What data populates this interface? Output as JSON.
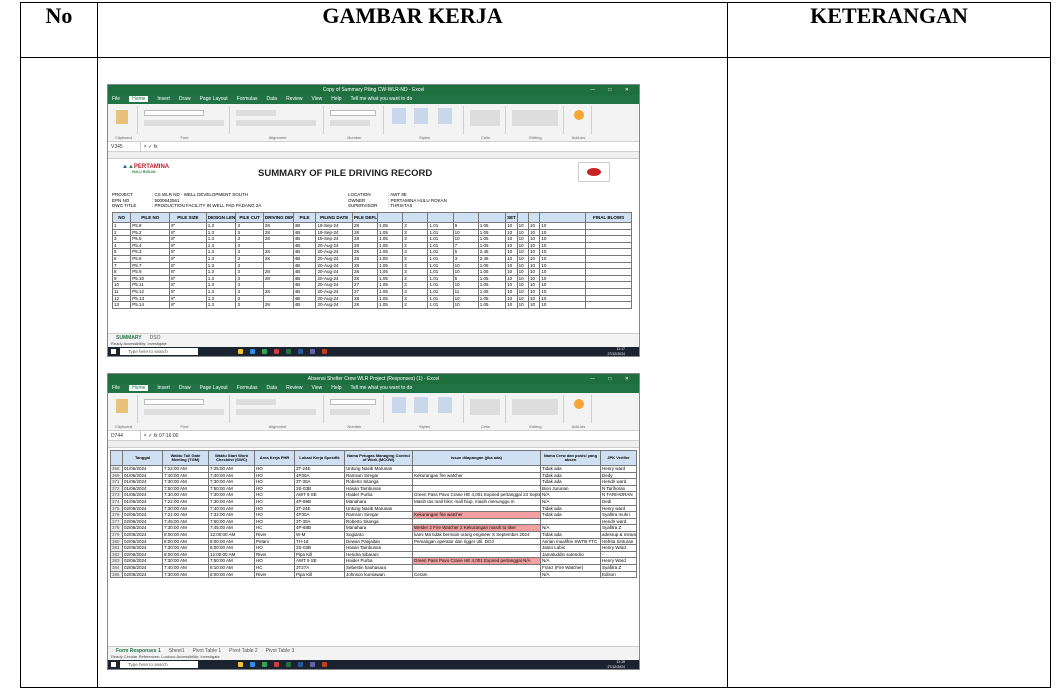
{
  "header": {
    "no": "No",
    "gambar": "GAMBAR KERJA",
    "keterangan": "KETERANGAN"
  },
  "shot1": {
    "window_title": "Copy of Summary Piling CW-WLR-ND - Excel",
    "menu": [
      "File",
      "Home",
      "Insert",
      "Draw",
      "Page Layout",
      "Formulas",
      "Data",
      "Review",
      "View",
      "Help",
      "Tell me what you want to do"
    ],
    "cell_ref": "V345",
    "company": "PERTAMINA",
    "company_sub": "HULU ROKAN",
    "sheet_title": "SUMMARY OF PILE DRIVING RECORD",
    "info_left": [
      {
        "k": "PROJECT",
        "v": ": CS WLR ND - WELL DEVELOPMENT SOUTH"
      },
      {
        "k": "EPN NO",
        "v": ": 5000642561"
      },
      {
        "k": "DWG TITLE",
        "v": ": PRODUCTION FACILITY IN WELL PAD PADANG 2A"
      }
    ],
    "info_right": [
      {
        "k": "LOCATION",
        "v": ": AWT 9E"
      },
      {
        "k": "OWNER",
        "v": ": PERTAMINA HULU ROKAN"
      },
      {
        "k": "SUPERVISOR",
        "v": ": THRISTAS"
      }
    ],
    "columns": [
      "NO",
      "PILE NO",
      "PILE SIZE",
      "DESIGN LENGTH",
      "PILE CUT",
      "DRIVING DEPTH",
      "PILE",
      "PILING DATE",
      "PILE DEFLECTION",
      "",
      "",
      "",
      "",
      "",
      "SET",
      "",
      "",
      "",
      "FINAL BLOWS",
      "REMARK"
    ],
    "rows": [
      [
        "1",
        "P5.8",
        "8\"",
        "1.3",
        "3",
        "28",
        "4B",
        "19-Sep-24",
        "28",
        "1.05",
        "3",
        "1.01",
        "9",
        "1.05",
        "10",
        "10",
        "10",
        "10"
      ],
      [
        "2",
        "P5.2",
        "8\"",
        "1.3",
        "3",
        "28",
        "4B",
        "19-Sep-24",
        "28",
        "1.05",
        "3",
        "1.01",
        "10",
        "1.05",
        "10",
        "10",
        "10",
        "10"
      ],
      [
        "3",
        "P5.5",
        "8\"",
        "1.3",
        "3",
        "28",
        "4B",
        "19-Sep-24",
        "28",
        "1.05",
        "3",
        "1.01",
        "10",
        "1.05",
        "10",
        "10",
        "10",
        "10"
      ],
      [
        "4",
        "P5.4",
        "8\"",
        "1.3",
        "3",
        "",
        "4B",
        "20-Aug-24",
        "28",
        "1.05",
        "2",
        "1.01",
        "7",
        "1.05",
        "10",
        "10",
        "10",
        "10"
      ],
      [
        "5",
        "P5.3",
        "8\"",
        "1.3",
        "3",
        "28",
        "4B",
        "20-Aug-24",
        "28",
        "1.05",
        "3",
        "1.01",
        "5",
        "2.46",
        "10",
        "10",
        "10",
        "10"
      ],
      [
        "6",
        "P5.6",
        "8\"",
        "1.3",
        "3",
        "28",
        "4B",
        "20-Aug-24",
        "28",
        "1.05",
        "2",
        "1.01",
        "3",
        "2.46",
        "10",
        "10",
        "10",
        "10"
      ],
      [
        "7",
        "P5.7",
        "8\"",
        "1.3",
        "3",
        "",
        "4B",
        "20-Aug-24",
        "28",
        "1.05",
        "3",
        "1.01",
        "10",
        "1.05",
        "10",
        "10",
        "10",
        "10"
      ],
      [
        "8",
        "P5.9",
        "8\"",
        "1.3",
        "3",
        "28",
        "4B",
        "20-Aug-24",
        "28",
        "1.05",
        "3",
        "1.01",
        "10",
        "1.05",
        "10",
        "10",
        "10",
        "10"
      ],
      [
        "9",
        "P5.10",
        "8\"",
        "1.3",
        "3",
        "28",
        "4B",
        "20-Aug-24",
        "28",
        "1.05",
        "2",
        "1.01",
        "5",
        "1.05",
        "10",
        "10",
        "10",
        "10"
      ],
      [
        "10",
        "P5.11",
        "8\"",
        "1.3",
        "3",
        "",
        "4B",
        "20-Aug-24",
        "27",
        "1.05",
        "3",
        "1.01",
        "10",
        "1.05",
        "10",
        "10",
        "10",
        "10"
      ],
      [
        "11",
        "P5.12",
        "8\"",
        "1.3",
        "3",
        "28",
        "4B",
        "20-Aug-24",
        "27",
        "1.05",
        "3",
        "1.01",
        "11",
        "1.05",
        "10",
        "10",
        "10",
        "10"
      ],
      [
        "12",
        "P5.13",
        "8\"",
        "1.3",
        "3",
        "",
        "4B",
        "20-Aug-24",
        "28",
        "1.05",
        "3",
        "1.01",
        "10",
        "1.05",
        "10",
        "10",
        "10",
        "10"
      ],
      [
        "13",
        "P5.14",
        "8\"",
        "1.3",
        "3",
        "28",
        "4B",
        "20-Aug-24",
        "28",
        "1.05",
        "2",
        "1.01",
        "10",
        "1.05",
        "10",
        "10",
        "10",
        "10"
      ]
    ],
    "sheets": [
      "SUMMARY",
      "DSO"
    ],
    "status": "Ready    Accessibility: Investigate",
    "search_placeholder": "Type here to search",
    "clock_time": "11:17",
    "clock_date": "27/12/2024"
  },
  "shot2": {
    "window_title": "Absensi Shelter Crew WLR Project (Responses) (1) - Excel",
    "menu": [
      "File",
      "Home",
      "Insert",
      "Draw",
      "Page Layout",
      "Formulas",
      "Data",
      "Review",
      "View",
      "Help",
      "Tell me what you want to do"
    ],
    "cell_ref": "D744",
    "formula": "07:16:00",
    "columns": [
      "Tanggal",
      "Waktu Toll Gate Meeting (TGM)",
      "Waktu Start Work Checklist (SWC)",
      "Area Kerja PHR",
      "Lokasi Kerja Spesifik",
      "Nama Petugas Managing Control of Work (MCOW)",
      "Issue dilapangan (jika ada)",
      "Nama Crew dan posisi yang absen",
      "JPK Verifier"
    ],
    "rows": [
      {
        "no": "368",
        "c": [
          "01/06/2024",
          "7:22:00 AM",
          "7:25:00 AM",
          "HO",
          "3T-24E",
          "Untung Nasib Marunan",
          "",
          "Tidak ada",
          "Henry ward"
        ]
      },
      {
        "no": "369",
        "c": [
          "01/06/2024",
          "7:40:00 AM",
          "7:40:00 AM",
          "HO",
          "4P30A",
          "Ramson Siregar",
          "Kekurangan fire watcher",
          "Tidak ada",
          "Dedy"
        ]
      },
      {
        "no": "371",
        "c": [
          "01/06/2024",
          "7:30:00 AM",
          "7:30:00 AM",
          "HO",
          "3T-30A",
          "Roberto Sitanga",
          "",
          "Tidak ada",
          "Hendri ward"
        ]
      },
      {
        "no": "372",
        "c": [
          "01/06/2024",
          "7:50:00 AM",
          "7:50:00 AM",
          "HO",
          "3S-03B",
          "Hasan Tambunan",
          "",
          "Bion Jurunan",
          "N Tarihoran"
        ]
      },
      {
        "no": "373",
        "c": [
          "01/06/2024",
          "7:30:00 AM",
          "7:30:00 AM",
          "HO",
          "AWT 9 SE",
          "Haider Purba",
          "Green Pass Pavo Crane HE 4,001 Expired pertanggal 24 September 2024",
          "N/A",
          "N TARIHORAN"
        ]
      },
      {
        "no": "374",
        "c": [
          "01/06/2024",
          "7:22:00 AM",
          "7:30:00 AM",
          "HO",
          "4P-89B",
          "Manahara",
          "Masih tas mall hiks; mall hiup, masih menunggu m",
          "N/A",
          "Dedi"
        ]
      },
      {
        "no": "375",
        "c": [
          "02/06/2024",
          "7:30:00 AM",
          "7:40:00 AM",
          "HO",
          "3T-24E",
          "Untung Nasib Marunan",
          "",
          "Tidak ada",
          "Henry ward"
        ]
      },
      {
        "no": "376",
        "c": [
          "02/06/2024",
          "7:21:00 AM",
          "7:32:00 AM",
          "HO",
          "4P30A",
          "Ramson Siregar",
          "Kekurangan fire watcher",
          "Tidak ada",
          "Syafitra muhri"
        ]
      },
      {
        "no": "377",
        "c": [
          "02/06/2024",
          "7:45:00 AM",
          "7:50:00 AM",
          "HO",
          "3T-30A",
          "Roberto Sitanga",
          "",
          "",
          "Hendri ward"
        ]
      },
      {
        "no": "378",
        "c": [
          "02/06/2024",
          "7:30:00 AM",
          "7:45:00 AM",
          "HC",
          "4P-68B",
          "Manahara",
          "Welder 2 Fire Watcher 2 Kekurangan masih to tiker",
          "N/A",
          "Syafitra Z"
        ]
      },
      {
        "no": "379",
        "c": [
          "02/06/2024",
          "8:00:00 AM",
          "12:00:00 AM",
          "River",
          "W-M",
          "Sugianto",
          "kami Ma tidak bermain orang engineer S September 2024",
          "Tidak ada",
          "adesrup & mirando"
        ]
      },
      {
        "no": "380",
        "c": [
          "02/06/2024",
          "8:00:00 AM",
          "8:00:00 AM",
          "Petani",
          "TH-18",
          "Dewan Panjaitan",
          "Pemangan operator dan rigger util. DOJ",
          "Asrian mualifrie SWTB FTC",
          "Hefrita Sinturan"
        ]
      },
      {
        "no": "381",
        "c": [
          "02/06/2024",
          "7:30:00 AM",
          "8:00:00 AM",
          "HO",
          "3S-03B",
          "Hasan Tambunan",
          "",
          "Janto Lubis",
          "Henry Ward"
        ]
      },
      {
        "no": "382",
        "c": [
          "02/06/2024",
          "8:00:00 AM",
          "12:00:00 AM",
          "River",
          "Pipa Kill",
          "Hendra Sibarani",
          "",
          "Jamaluddin sutendro",
          "-"
        ]
      },
      {
        "no": "383",
        "c": [
          "02/06/2024",
          "7:30:00 AM",
          "7:50:00 AM",
          "HO",
          "AWT 9 SE",
          "Haider Purba",
          "Green Pass Pavo Crane HE 4,001 Expired pertanggal N/A",
          "N/A",
          "Henry Ward"
        ]
      },
      {
        "no": "384",
        "c": [
          "02/06/2024",
          "7:40:00 AM",
          "8:10:00 AM",
          "HC",
          "3T27A",
          "Sebestin haohasara",
          "",
          "Franz (Fire Watcher)",
          "Syafitra Z"
        ]
      },
      {
        "no": "385",
        "c": [
          "02/06/2024",
          "7:30:00 AM",
          "8:00:00 AM",
          "River",
          "Pipa Kill",
          "Johnson kurniawan",
          "Ceram",
          "N/A",
          "Edison"
        ]
      }
    ],
    "sheets": [
      "Form Responses 1",
      "Sheet1",
      "Pivot Table 1",
      "Pivot Table 2",
      "Pivot Table 3"
    ],
    "status": "Ready    Circular References: Lookout    Accessibility: Investigate",
    "search_placeholder": "Type here to search",
    "clock_time": "11:19",
    "clock_date": "27/12/2024"
  }
}
